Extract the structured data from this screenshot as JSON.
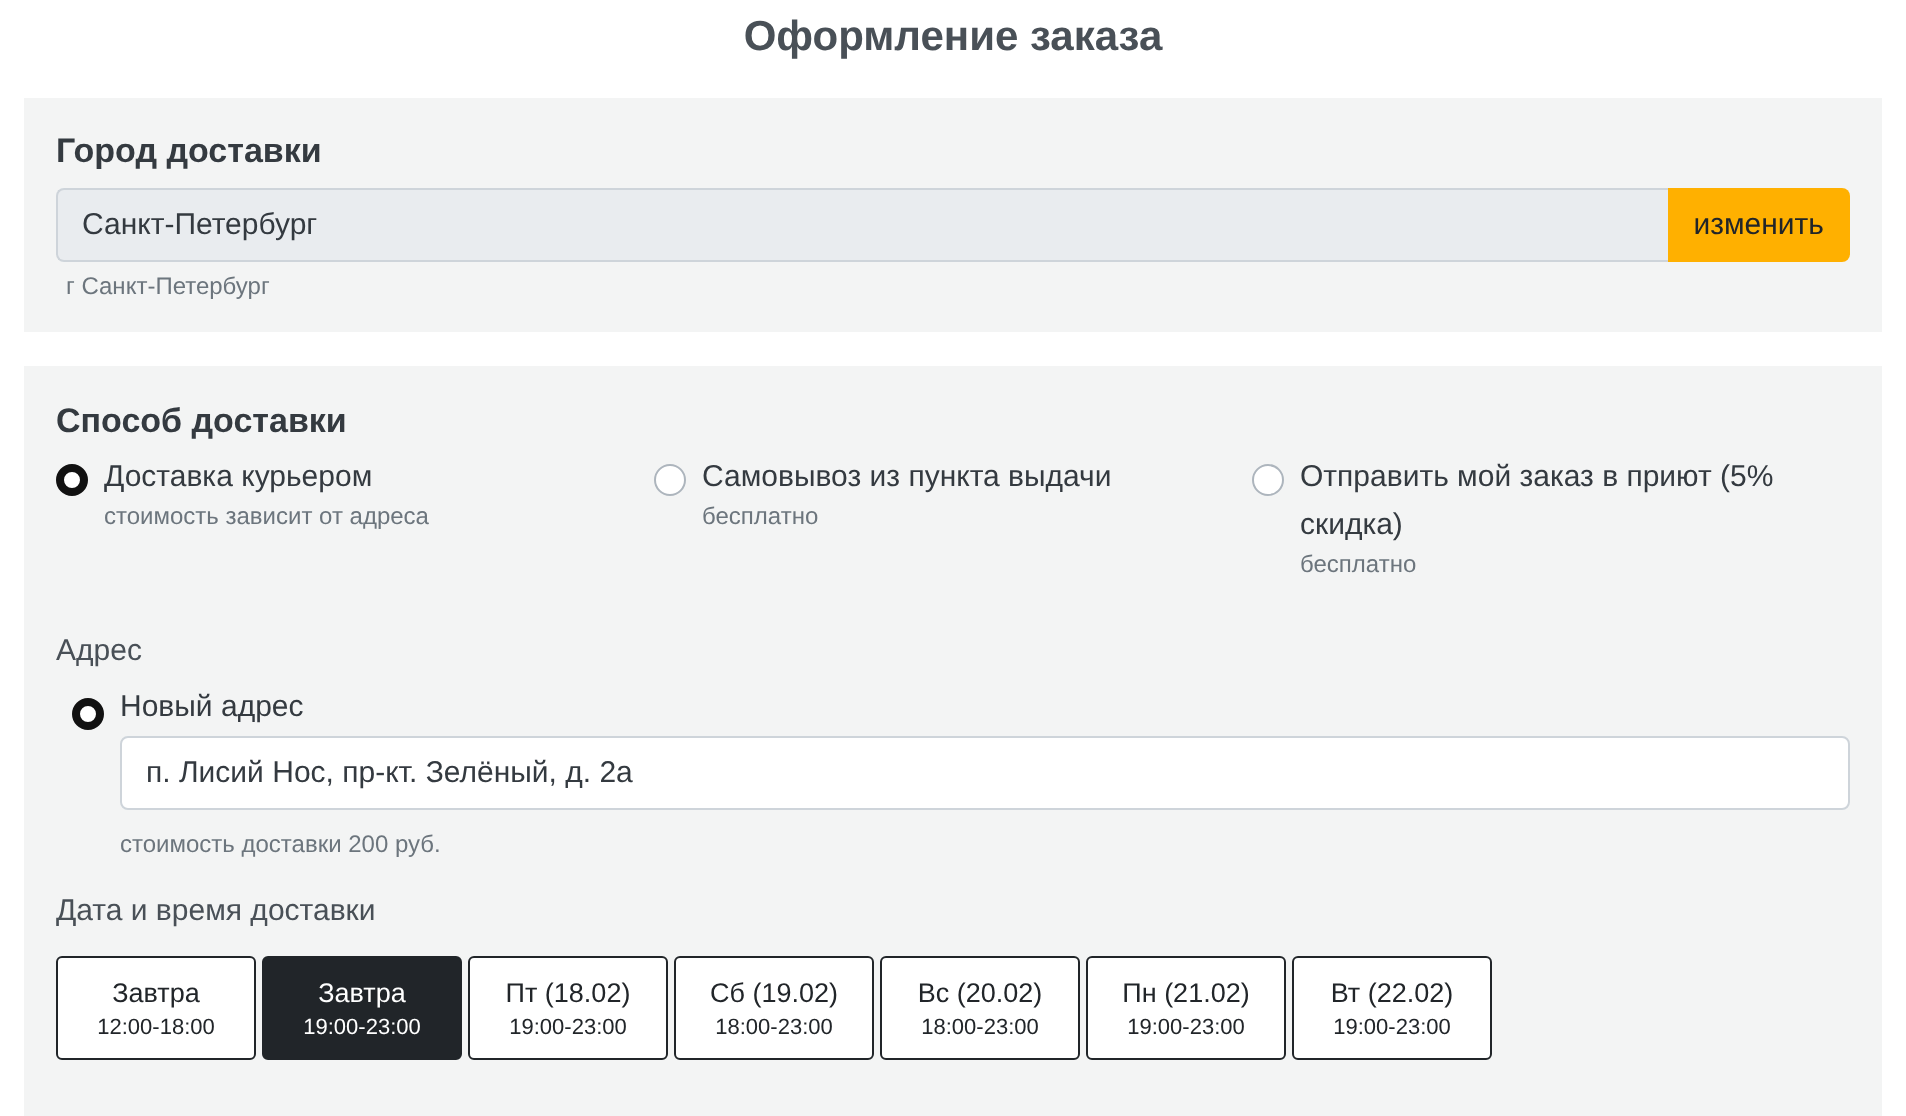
{
  "title": "Оформление заказа",
  "city": {
    "heading": "Город доставки",
    "value": "Санкт-Петербург",
    "button": "изменить",
    "hint": "г Санкт-Петербург"
  },
  "delivery": {
    "heading": "Способ доставки",
    "options": [
      {
        "label": "Доставка курьером",
        "note": "стоимость зависит от адреса",
        "selected": true
      },
      {
        "label": "Самовывоз из пункта выдачи",
        "note": "бесплатно",
        "selected": false
      },
      {
        "label": "Отправить мой заказ в приют (5% скидка)",
        "note": "бесплатно",
        "selected": false
      }
    ]
  },
  "address": {
    "label": "Адрес",
    "options": [
      {
        "label": "Новый адрес",
        "selected": true,
        "value": "п. Лисий Нос, пр-кт. Зелёный, д. 2а",
        "hint": "стоимость доставки 200 руб."
      }
    ]
  },
  "schedule": {
    "label": "Дата и время доставки",
    "slots": [
      {
        "day": "Завтра",
        "time": "12:00-18:00",
        "selected": false
      },
      {
        "day": "Завтра",
        "time": "19:00-23:00",
        "selected": true
      },
      {
        "day": "Пт (18.02)",
        "time": "19:00-23:00",
        "selected": false
      },
      {
        "day": "Сб (19.02)",
        "time": "18:00-23:00",
        "selected": false
      },
      {
        "day": "Вс (20.02)",
        "time": "18:00-23:00",
        "selected": false
      },
      {
        "day": "Пн (21.02)",
        "time": "19:00-23:00",
        "selected": false
      },
      {
        "day": "Вт (22.02)",
        "time": "19:00-23:00",
        "selected": false
      }
    ]
  }
}
